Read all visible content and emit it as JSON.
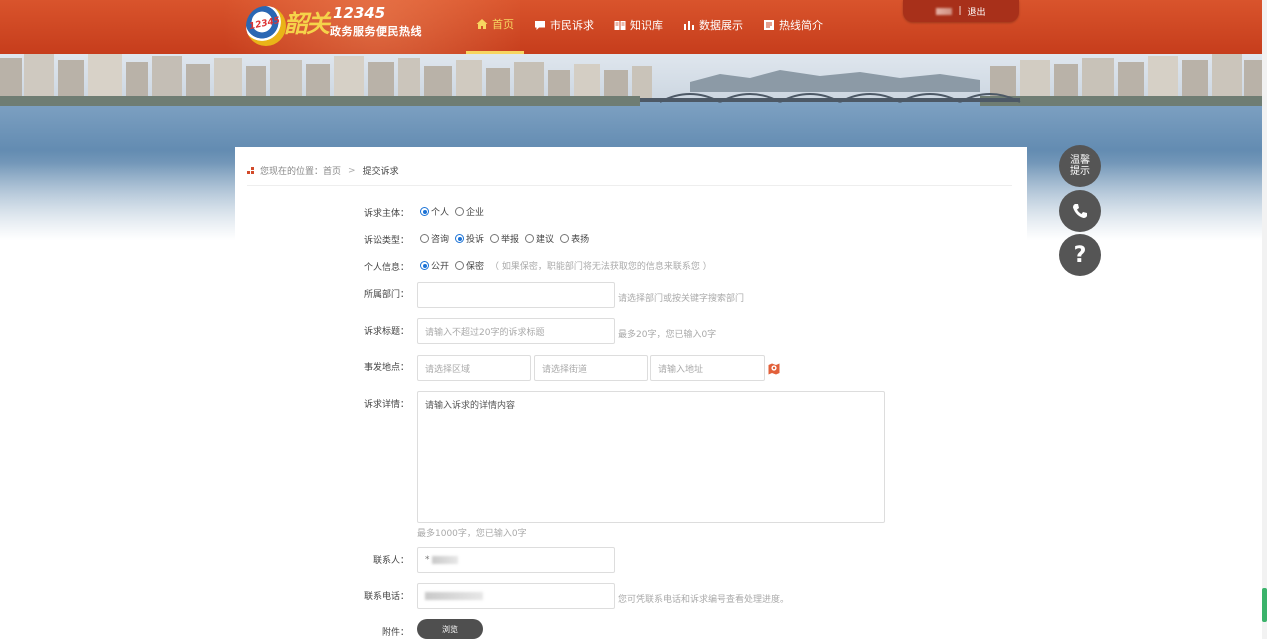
{
  "header": {
    "logo": {
      "badge": "12345",
      "calligraphy": "韶关",
      "number": "12345",
      "subtitle": "政务服务便民热线"
    },
    "nav": [
      {
        "label": "首页",
        "icon": "home-icon",
        "active": true
      },
      {
        "label": "市民诉求",
        "icon": "chat-icon",
        "active": false
      },
      {
        "label": "知识库",
        "icon": "book-icon",
        "active": false
      },
      {
        "label": "数据展示",
        "icon": "bar-chart-icon",
        "active": false
      },
      {
        "label": "热线简介",
        "icon": "document-icon",
        "active": false
      }
    ],
    "user": {
      "separator": "|",
      "logout": "退出"
    }
  },
  "breadcrumb": {
    "prefix": "您现在的位置：首页",
    "separator": ">",
    "current": "提交诉求"
  },
  "form": {
    "subject": {
      "label": "诉求主体：",
      "options": [
        {
          "text": "个人",
          "checked": true
        },
        {
          "text": "企业",
          "checked": false
        }
      ]
    },
    "type": {
      "label": "诉讼类型：",
      "options": [
        {
          "text": "咨询",
          "checked": false
        },
        {
          "text": "投诉",
          "checked": true
        },
        {
          "text": "举报",
          "checked": false
        },
        {
          "text": "建议",
          "checked": false
        },
        {
          "text": "表扬",
          "checked": false
        }
      ]
    },
    "privacy": {
      "label": "个人信息：",
      "options": [
        {
          "text": "公开",
          "checked": true
        },
        {
          "text": "保密",
          "checked": false
        }
      ],
      "note": "（ 如果保密，职能部门将无法获取您的信息来联系您 ）"
    },
    "department": {
      "label": "所属部门：",
      "value": "",
      "help": "请选择部门或按关键字搜索部门"
    },
    "title": {
      "label": "诉求标题：",
      "placeholder": "请输入不超过20字的诉求标题",
      "help": "最多20字，您已输入0字"
    },
    "location": {
      "label": "事发地点：",
      "area": "请选择区域",
      "street": "请选择街道",
      "address": "请输入地址"
    },
    "detail": {
      "label": "诉求详情：",
      "placeholder": "请输入诉求的详情内容",
      "counter": "最多1000字，您已输入0字"
    },
    "contact": {
      "label": "联系人：",
      "value_prefix": "*"
    },
    "phone": {
      "label": "联系电话：",
      "help": "您可凭联系电话和诉求编号查看处理进度。"
    },
    "attachment": {
      "label": "附件：",
      "button": "浏览"
    }
  },
  "float": {
    "tip": "温馨\n提示",
    "phone_icon": "phone-icon",
    "help_icon": "question-icon",
    "help_glyph": "?"
  },
  "colors": {
    "header": "#c9421f",
    "accent": "#f7d560",
    "radio": "#1c73d6"
  }
}
